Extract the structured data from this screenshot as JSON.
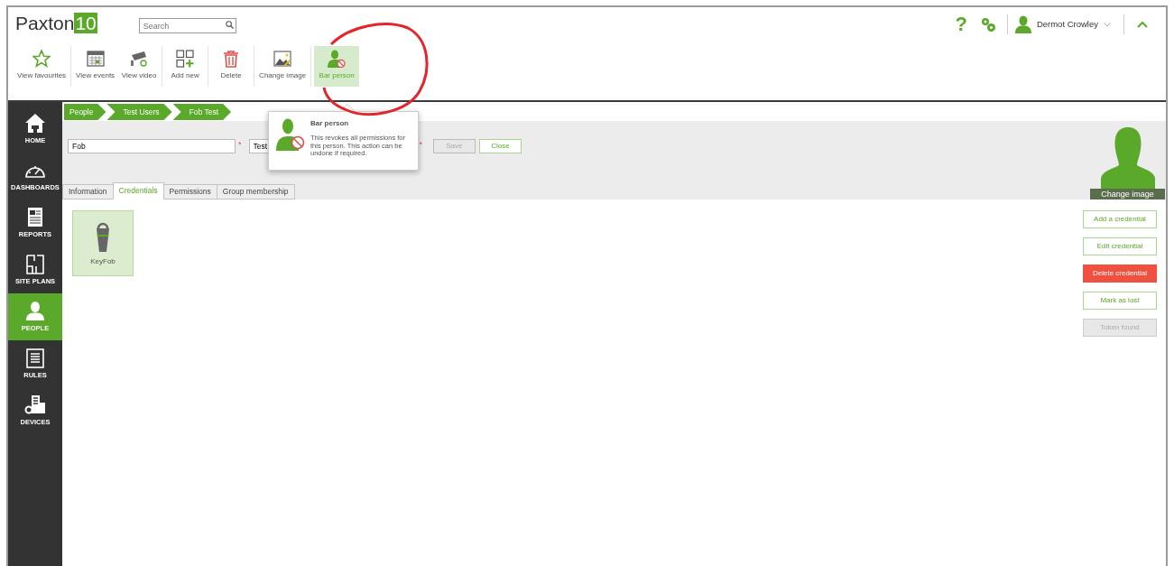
{
  "logo": {
    "text": "Paxton",
    "badge": "10"
  },
  "search": {
    "placeholder": "Search"
  },
  "header_right": {
    "help": "?",
    "user_name": "Dermot Crowley"
  },
  "toolbar": [
    {
      "items": [
        {
          "label": "View favourites",
          "kind": "star",
          "selected": false
        }
      ]
    },
    {
      "items": [
        {
          "label": "View events",
          "kind": "calendar",
          "selected": false
        },
        {
          "label": "View video",
          "kind": "camera",
          "selected": false
        }
      ]
    },
    {
      "items": [
        {
          "label": "Add new",
          "kind": "add",
          "selected": false
        }
      ]
    },
    {
      "items": [
        {
          "label": "Delete",
          "kind": "trash",
          "selected": false
        }
      ]
    },
    {
      "items": [
        {
          "label": "Change image",
          "kind": "image",
          "selected": false
        }
      ]
    },
    {
      "items": [
        {
          "label": "Bar person",
          "kind": "bar",
          "selected": true
        }
      ]
    }
  ],
  "sidebar": [
    {
      "label": "HOME",
      "kind": "home",
      "selected": false
    },
    {
      "label": "DASHBOARDS",
      "kind": "gauge",
      "selected": false
    },
    {
      "label": "REPORTS",
      "kind": "report",
      "selected": false
    },
    {
      "label": "SITE PLANS",
      "kind": "plan",
      "selected": false
    },
    {
      "label": "PEOPLE",
      "kind": "person",
      "selected": true
    },
    {
      "label": "RULES",
      "kind": "rules",
      "selected": false
    },
    {
      "label": "DEVICES",
      "kind": "devices",
      "selected": false
    }
  ],
  "breadcrumb": [
    "People",
    "Test Users",
    "Fob Test"
  ],
  "form": {
    "required_mark": "*",
    "fields": [
      {
        "value": "Fob",
        "required": true
      },
      {
        "value": "Test",
        "required": true
      }
    ],
    "buttons": [
      {
        "label": "Save",
        "disabled": true
      },
      {
        "label": "Close",
        "disabled": false
      }
    ]
  },
  "tabs": [
    {
      "label": "Information",
      "selected": false
    },
    {
      "label": "Credentials",
      "selected": true
    },
    {
      "label": "Permissions",
      "selected": false
    },
    {
      "label": "Group membership",
      "selected": false
    }
  ],
  "avatar": {
    "caption": "Change image"
  },
  "credentials": [
    {
      "label": "KeyFob",
      "selected": true
    }
  ],
  "actions": [
    {
      "label": "Add a credential",
      "kind": "outline",
      "disabled": false
    },
    {
      "label": "Edit credential",
      "kind": "outline",
      "disabled": false
    },
    {
      "label": "Delete credential",
      "kind": "danger",
      "disabled": false
    },
    {
      "label": "Mark as lost",
      "kind": "outline",
      "disabled": false
    },
    {
      "label": "Token found",
      "kind": "outline",
      "disabled": true
    }
  ],
  "tooltip": {
    "title": "Bar person",
    "text": "This revokes all permissions for this person. This action can be undone if required."
  }
}
